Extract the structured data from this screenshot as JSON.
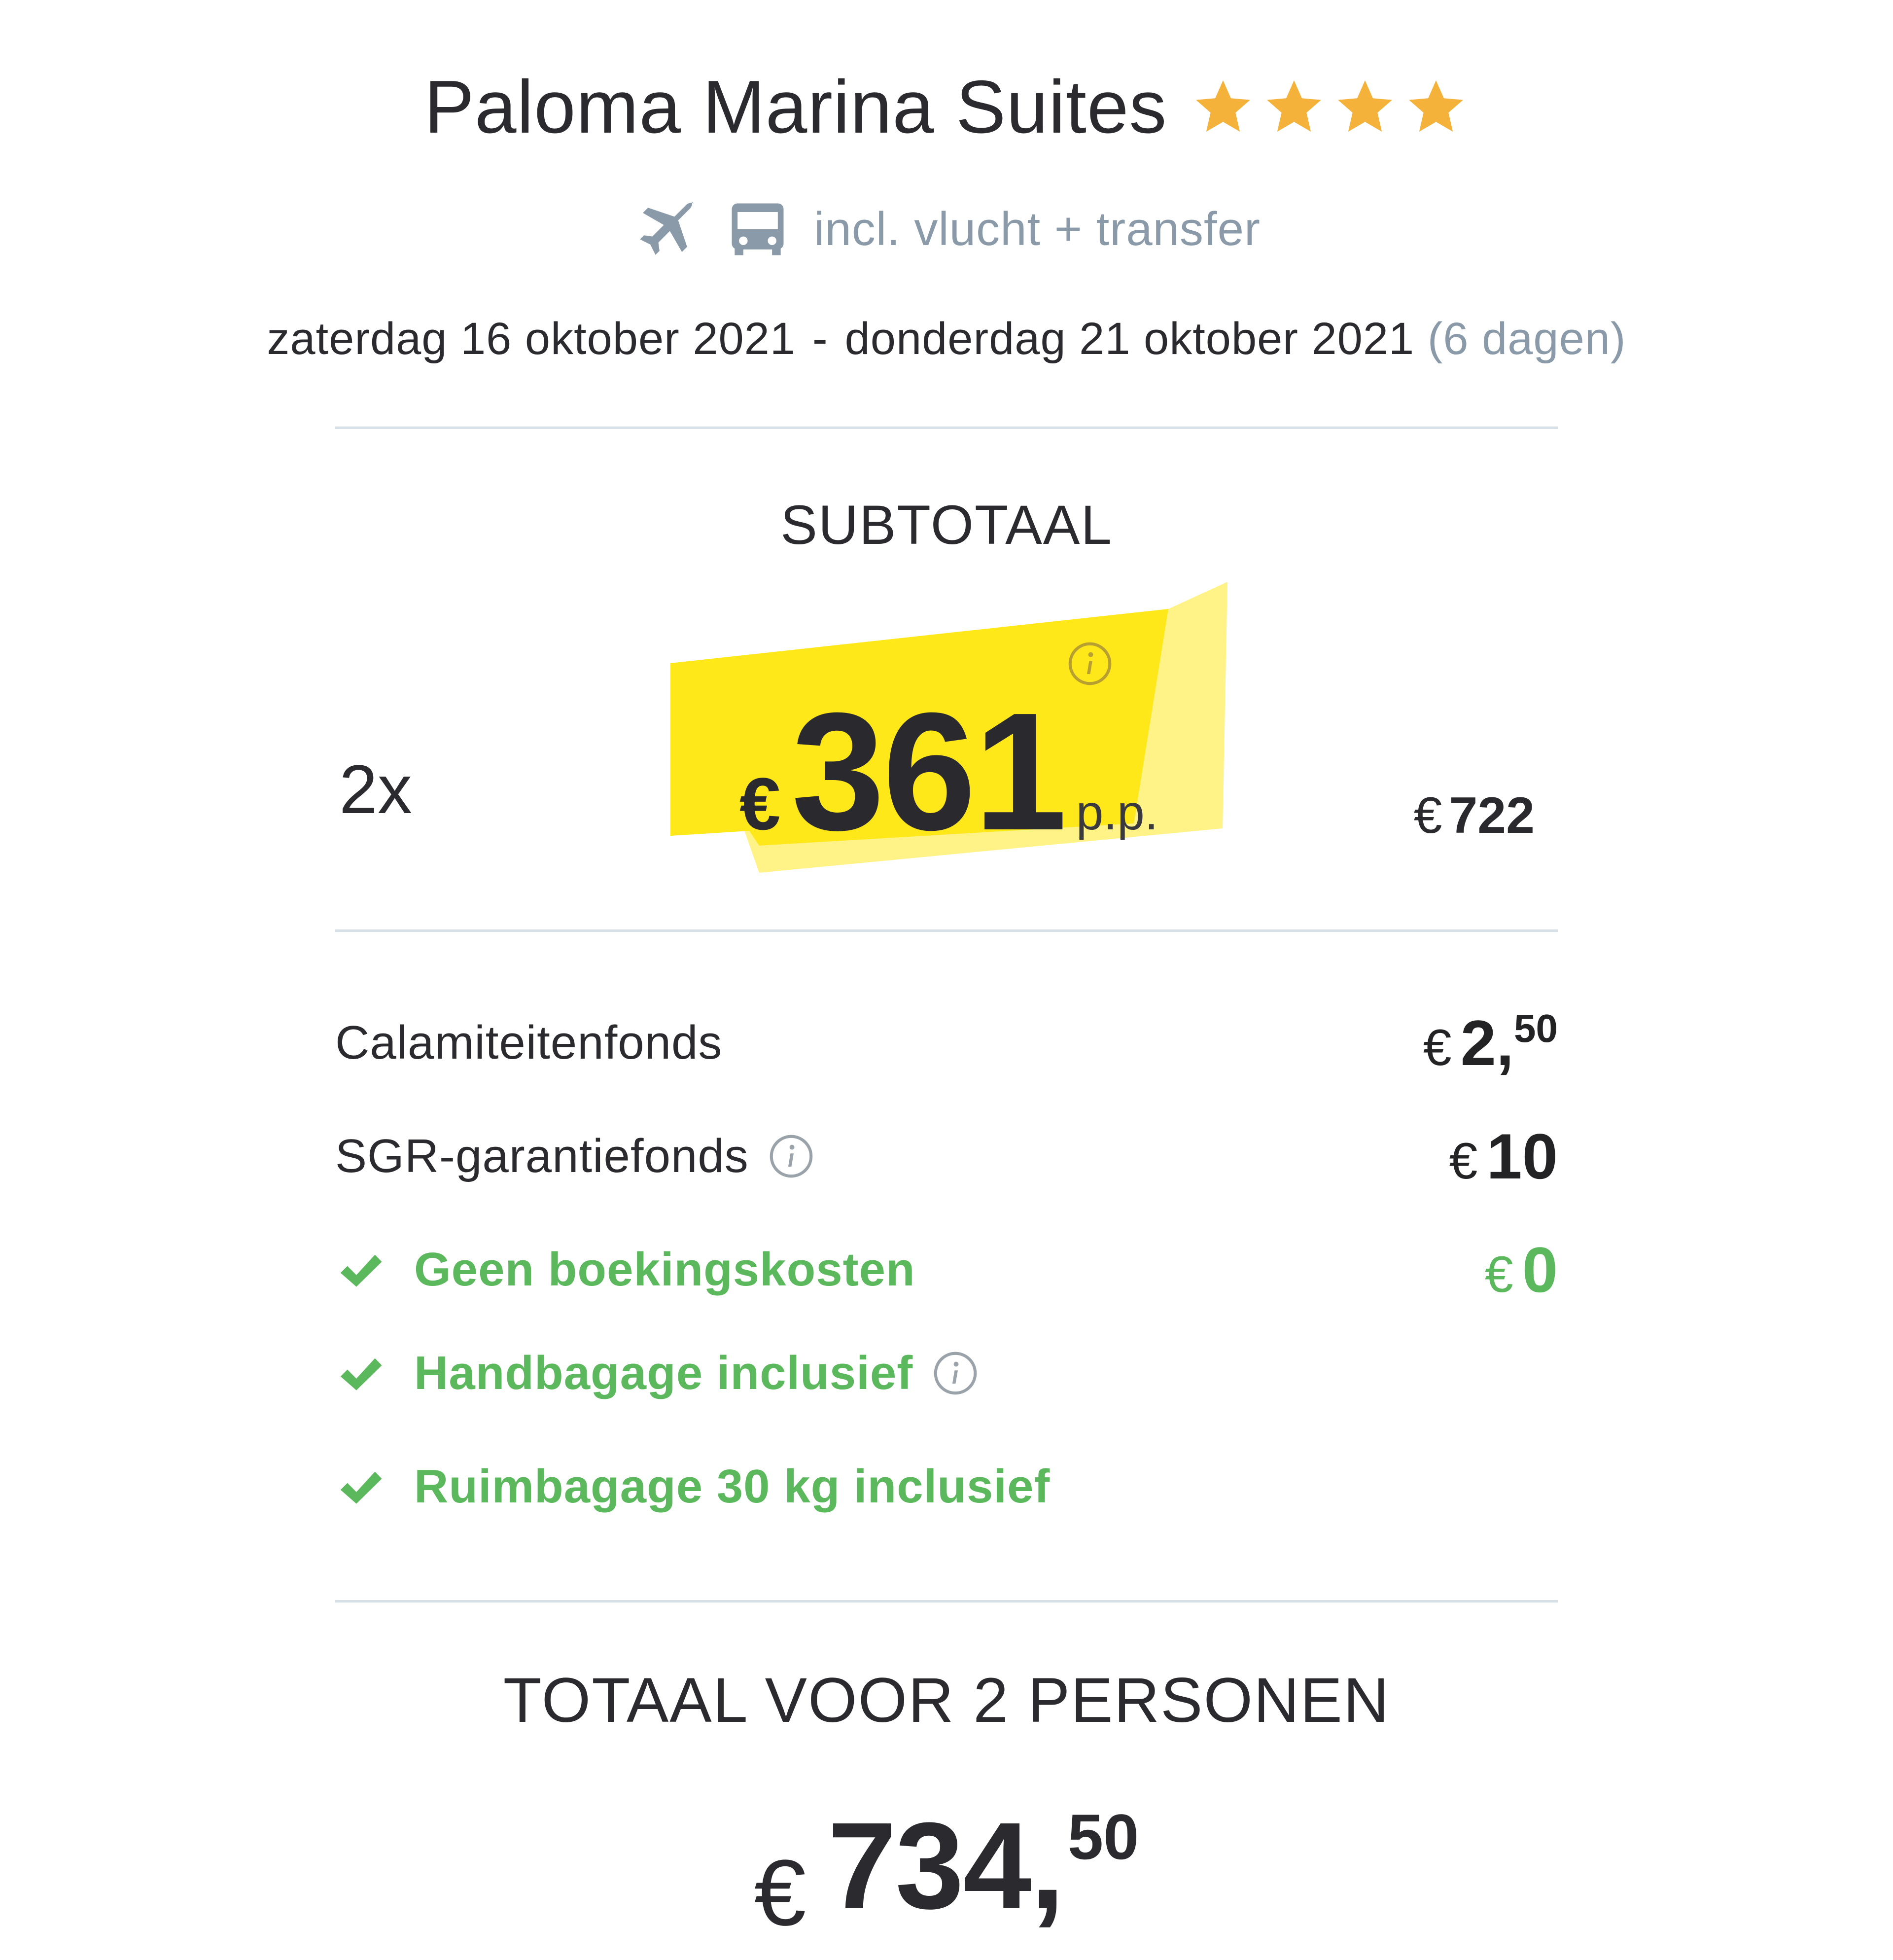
{
  "header": {
    "hotel_name": "Paloma Marina Suites",
    "star_rating": 4,
    "star_color": "#f4b23a",
    "travel_icons": [
      "plane-icon",
      "bus-icon"
    ],
    "travel_text": "incl. vlucht + transfer"
  },
  "dates": {
    "start": "zaterdag 16 oktober 2021",
    "separator": "-",
    "end": "donderdag 21 oktober 2021",
    "duration": "(6 dagen)"
  },
  "subtotal": {
    "label": "SUBTOTAAL",
    "quantity": "2x",
    "currency": "€",
    "price_per_person": "361",
    "per_person_label": "p.p.",
    "row_total": "722",
    "highlight_color": "#ffe81a"
  },
  "line_items": [
    {
      "label": "Calamiteitenfonds",
      "value_main": "2,",
      "value_sup": "50"
    },
    {
      "label": "SGR-garantiefonds",
      "value_main": "10",
      "info_icon": "info-icon"
    },
    {
      "label": "Geen boekingskosten",
      "value_main": "0",
      "checked": true
    },
    {
      "label": "Handbagage inclusief",
      "checked": true,
      "info_icon": "info-icon"
    },
    {
      "label": "Ruimbagage 30 kg inclusief",
      "checked": true
    }
  ],
  "total": {
    "label": "TOTAAL VOOR 2 PERSONEN",
    "currency": "€",
    "value_main": "734,",
    "value_sup": "50"
  },
  "colors": {
    "green": "#5cb85c",
    "muted": "#8a9aa8",
    "divider": "#d7e0e6",
    "star": "#f4b23a"
  }
}
